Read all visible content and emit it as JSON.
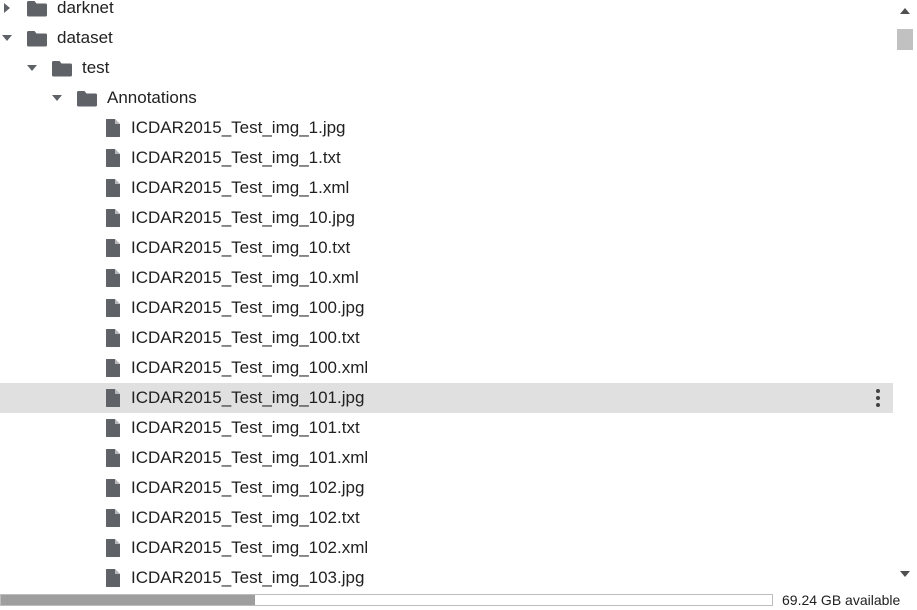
{
  "file_tree": {
    "items": [
      {
        "name": "darknet",
        "type": "folder",
        "expanded": false,
        "depth": 0,
        "selected": false
      },
      {
        "name": "dataset",
        "type": "folder",
        "expanded": true,
        "depth": 0,
        "selected": false
      },
      {
        "name": "test",
        "type": "folder",
        "expanded": true,
        "depth": 1,
        "selected": false
      },
      {
        "name": "Annotations",
        "type": "folder",
        "expanded": true,
        "depth": 2,
        "selected": false
      },
      {
        "name": "ICDAR2015_Test_img_1.jpg",
        "type": "file",
        "depth": 3,
        "selected": false
      },
      {
        "name": "ICDAR2015_Test_img_1.txt",
        "type": "file",
        "depth": 3,
        "selected": false
      },
      {
        "name": "ICDAR2015_Test_img_1.xml",
        "type": "file",
        "depth": 3,
        "selected": false
      },
      {
        "name": "ICDAR2015_Test_img_10.jpg",
        "type": "file",
        "depth": 3,
        "selected": false
      },
      {
        "name": "ICDAR2015_Test_img_10.txt",
        "type": "file",
        "depth": 3,
        "selected": false
      },
      {
        "name": "ICDAR2015_Test_img_10.xml",
        "type": "file",
        "depth": 3,
        "selected": false
      },
      {
        "name": "ICDAR2015_Test_img_100.jpg",
        "type": "file",
        "depth": 3,
        "selected": false
      },
      {
        "name": "ICDAR2015_Test_img_100.txt",
        "type": "file",
        "depth": 3,
        "selected": false
      },
      {
        "name": "ICDAR2015_Test_img_100.xml",
        "type": "file",
        "depth": 3,
        "selected": false
      },
      {
        "name": "ICDAR2015_Test_img_101.jpg",
        "type": "file",
        "depth": 3,
        "selected": true
      },
      {
        "name": "ICDAR2015_Test_img_101.txt",
        "type": "file",
        "depth": 3,
        "selected": false
      },
      {
        "name": "ICDAR2015_Test_img_101.xml",
        "type": "file",
        "depth": 3,
        "selected": false
      },
      {
        "name": "ICDAR2015_Test_img_102.jpg",
        "type": "file",
        "depth": 3,
        "selected": false
      },
      {
        "name": "ICDAR2015_Test_img_102.txt",
        "type": "file",
        "depth": 3,
        "selected": false
      },
      {
        "name": "ICDAR2015_Test_img_102.xml",
        "type": "file",
        "depth": 3,
        "selected": false
      },
      {
        "name": "ICDAR2015_Test_img_103.jpg",
        "type": "file",
        "depth": 3,
        "selected": false
      }
    ],
    "icons": {
      "folder": "folder-icon",
      "file": "file-icon",
      "expanded": "caret-down-icon",
      "collapsed": "caret-right-icon",
      "more": "more-vert-icon"
    }
  },
  "disk": {
    "available_label": "69.24 GB available",
    "used_fraction": 0.33
  },
  "colors": {
    "selected_row": "#e0e0e0",
    "icon": "#5f6368",
    "text": "#212121",
    "disk_fill": "#9e9e9e"
  }
}
